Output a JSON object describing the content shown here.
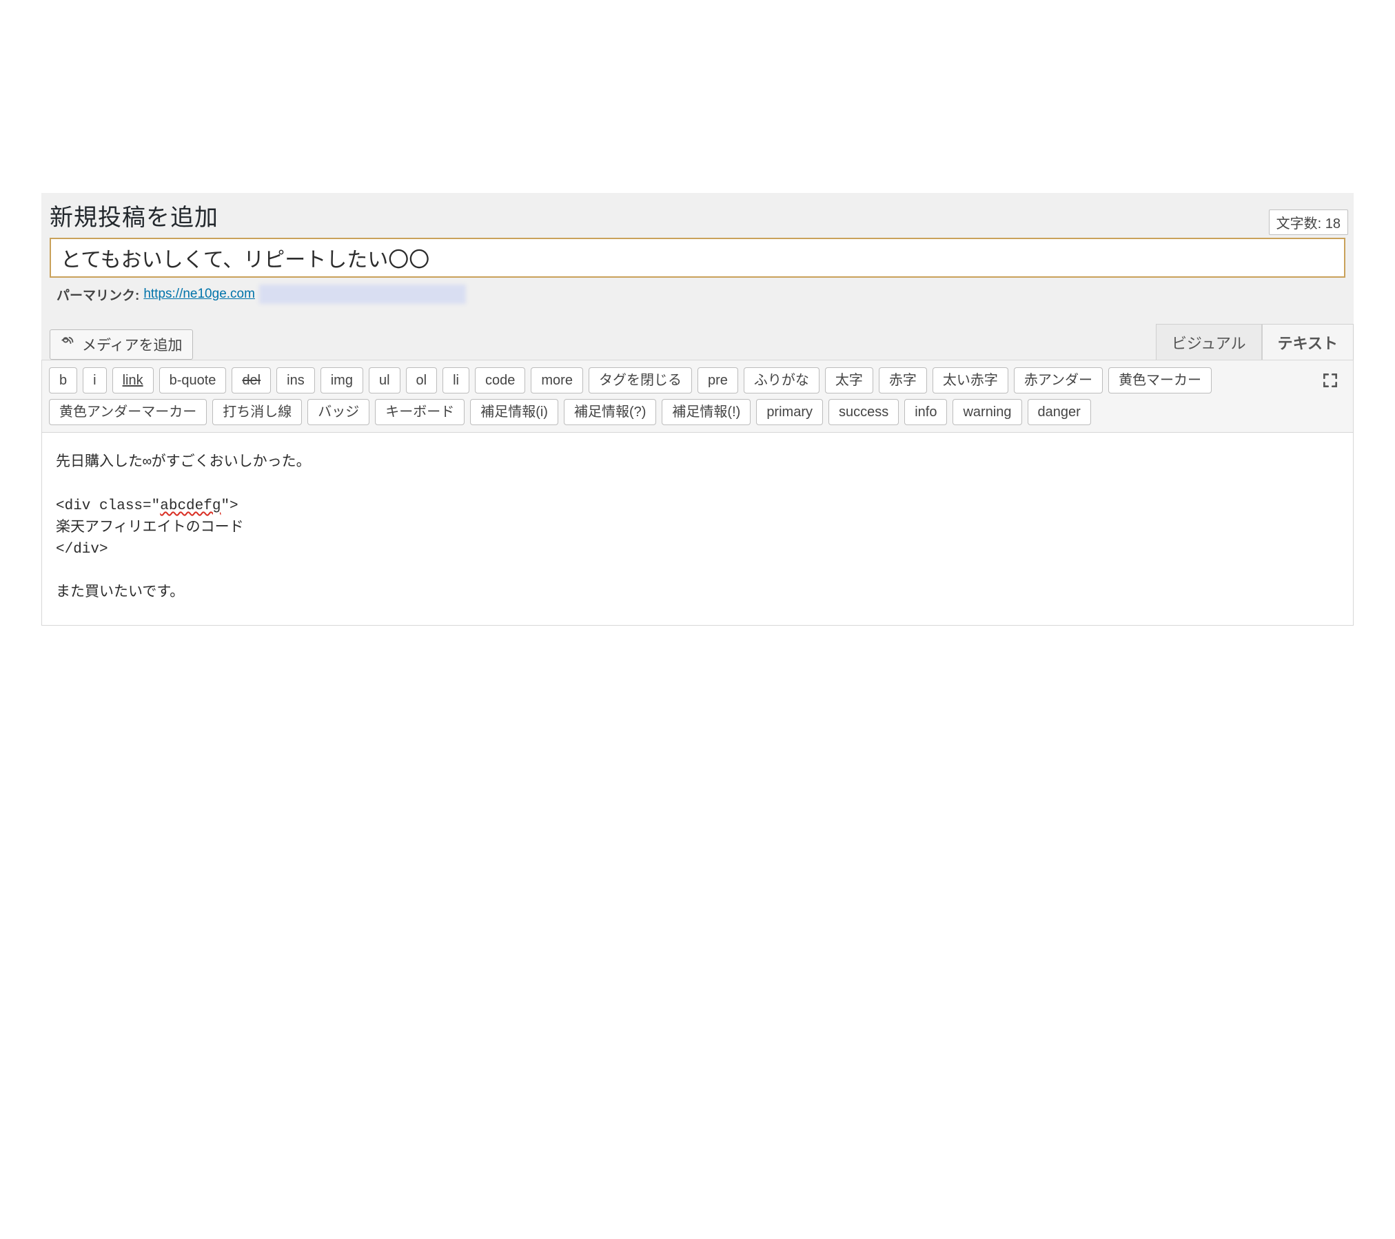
{
  "page": {
    "title": "新規投稿を追加",
    "char_count_label": "文字数:",
    "char_count_value": "18"
  },
  "post": {
    "title_value": "とてもおいしくて、リピートしたい〇〇"
  },
  "permalink": {
    "label": "パーマリンク:",
    "url_text": "https://ne10ge.com"
  },
  "media": {
    "button_label": "メディアを追加"
  },
  "tabs": {
    "visual": "ビジュアル",
    "text": "テキスト"
  },
  "toolbar": {
    "row": [
      "b",
      "i",
      "link",
      "b-quote",
      "del",
      "ins",
      "img",
      "ul",
      "ol",
      "li",
      "code",
      "more",
      "タグを閉じる",
      "pre",
      "ふりがな",
      "太字",
      "赤字",
      "太い赤字",
      "赤アンダー",
      "黄色マーカー",
      "黄色アンダーマーカー",
      "打ち消し線",
      "バッジ",
      "キーボード",
      "補足情報(i)",
      "補足情報(?)",
      "補足情報(!)",
      "primary",
      "success",
      "info",
      "warning",
      "danger"
    ]
  },
  "content": {
    "line1": "先日購入した∞がすごくおいしかった。",
    "line2_open_pre": "<div class=\"",
    "line2_class": "abcdefg",
    "line2_open_post": "\">",
    "line3": "楽天アフィリエイトのコード",
    "line4": "</div>",
    "line5": "また買いたいです。"
  }
}
